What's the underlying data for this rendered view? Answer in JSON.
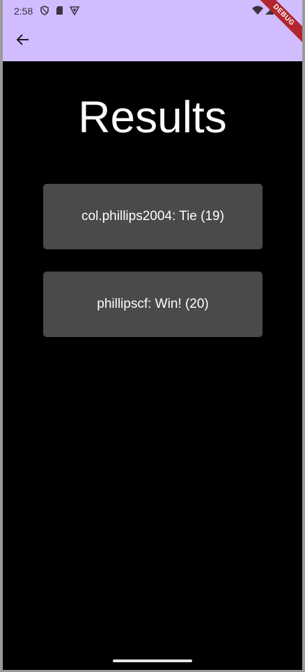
{
  "status_bar": {
    "time": "2:58"
  },
  "header": {
    "back_icon": "arrow-left-icon",
    "debug_banner": "DEBUG",
    "color": "#d0bcff"
  },
  "page": {
    "title": "Results"
  },
  "results": [
    {
      "label": "col.phillips2004: Tie (19)"
    },
    {
      "label": "phillipscf: Win! (20)"
    }
  ],
  "colors": {
    "background": "#000000",
    "card": "#4a4a4a",
    "accent": "#d0bcff"
  }
}
